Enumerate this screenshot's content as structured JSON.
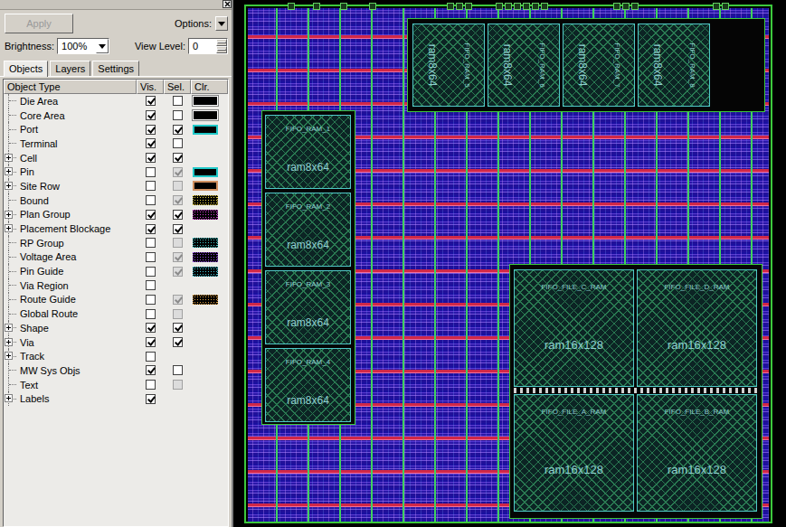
{
  "toolbar": {
    "apply": {
      "label": "Apply",
      "disabled": true
    },
    "options_label": "Options:",
    "brightness_label": "Brightness:",
    "brightness": "100%",
    "view_level_label": "View Level:",
    "view_level": "0"
  },
  "tabs": [
    {
      "label": "Objects",
      "selected": true
    },
    {
      "label": "Layers",
      "selected": false
    },
    {
      "label": "Settings",
      "selected": false
    }
  ],
  "table": {
    "columns": [
      "Object Type",
      "Vis.",
      "Sel.",
      "Clr."
    ],
    "rows": [
      {
        "name": "Die Area",
        "expandable": false,
        "vis": true,
        "sel": {
          "checked": false,
          "disabled": false
        },
        "clr": {
          "kind": "solid",
          "color": "#000000"
        }
      },
      {
        "name": "Core Area",
        "expandable": false,
        "vis": true,
        "sel": {
          "checked": false,
          "disabled": false
        },
        "clr": {
          "kind": "solid",
          "color": "#000000"
        }
      },
      {
        "name": "Port",
        "expandable": false,
        "vis": true,
        "sel": {
          "checked": true,
          "disabled": false
        },
        "clr": {
          "kind": "outline",
          "color": "#20c8c8"
        }
      },
      {
        "name": "Terminal",
        "expandable": false,
        "vis": true,
        "sel": {
          "checked": false,
          "disabled": false
        },
        "clr": null
      },
      {
        "name": "Cell",
        "expandable": true,
        "vis": true,
        "sel": {
          "checked": true,
          "disabled": false
        },
        "clr": null
      },
      {
        "name": "Pin",
        "expandable": true,
        "vis": false,
        "sel": {
          "checked": true,
          "disabled": true
        },
        "clr": {
          "kind": "outline",
          "color": "#20c8c8"
        }
      },
      {
        "name": "Site Row",
        "expandable": true,
        "vis": false,
        "sel": {
          "checked": false,
          "disabled": true
        },
        "clr": {
          "kind": "outline",
          "color": "#d09060"
        }
      },
      {
        "name": "Bound",
        "expandable": false,
        "vis": false,
        "sel": {
          "checked": true,
          "disabled": true
        },
        "clr": {
          "kind": "dotted",
          "color": "#e8d040"
        }
      },
      {
        "name": "Plan Group",
        "expandable": true,
        "vis": true,
        "sel": {
          "checked": true,
          "disabled": false
        },
        "clr": {
          "kind": "dotted",
          "color": "#d040d0"
        }
      },
      {
        "name": "Placement Blockage",
        "expandable": true,
        "vis": true,
        "sel": {
          "checked": true,
          "disabled": false
        },
        "clr": null
      },
      {
        "name": "RP Group",
        "expandable": false,
        "vis": false,
        "sel": {
          "checked": false,
          "disabled": true
        },
        "clr": {
          "kind": "dotted",
          "color": "#40c8c8"
        }
      },
      {
        "name": "Voltage Area",
        "expandable": false,
        "vis": false,
        "sel": {
          "checked": true,
          "disabled": true
        },
        "clr": {
          "kind": "dotted",
          "color": "#9048e0"
        }
      },
      {
        "name": "Pin Guide",
        "expandable": false,
        "vis": false,
        "sel": {
          "checked": true,
          "disabled": true
        },
        "clr": {
          "kind": "dotted",
          "color": "#40c8d8"
        }
      },
      {
        "name": "Via Region",
        "expandable": false,
        "vis": false,
        "sel": null,
        "clr": null
      },
      {
        "name": "Route Guide",
        "expandable": false,
        "vis": false,
        "sel": {
          "checked": true,
          "disabled": true
        },
        "clr": {
          "kind": "dotted",
          "color": "#e0a040"
        }
      },
      {
        "name": "Global Route",
        "expandable": false,
        "vis": false,
        "sel": {
          "checked": false,
          "disabled": true
        },
        "clr": null
      },
      {
        "name": "Shape",
        "expandable": true,
        "vis": true,
        "sel": {
          "checked": true,
          "disabled": false
        },
        "clr": null
      },
      {
        "name": "Via",
        "expandable": true,
        "vis": true,
        "sel": {
          "checked": true,
          "disabled": false
        },
        "clr": null
      },
      {
        "name": "Track",
        "expandable": true,
        "vis": false,
        "sel": null,
        "clr": null
      },
      {
        "name": "MW Sys Objs",
        "expandable": false,
        "vis": true,
        "sel": {
          "checked": false,
          "disabled": false
        },
        "clr": null
      },
      {
        "name": "Text",
        "expandable": false,
        "vis": false,
        "sel": {
          "checked": false,
          "disabled": true
        },
        "clr": null
      },
      {
        "name": "Labels",
        "expandable": true,
        "vis": true,
        "sel": null,
        "clr": null
      }
    ]
  },
  "layout": {
    "macros": [
      {
        "name": "FIFO_RAM_5",
        "cell": "ram8x64",
        "kind": "top"
      },
      {
        "name": "FIFO_RAM_6",
        "cell": "ram8x64",
        "kind": "top"
      },
      {
        "name": "FIFO_RAM_7",
        "cell": "ram8x64",
        "kind": "top"
      },
      {
        "name": "FIFO_RAM_8",
        "cell": "ram8x64",
        "kind": "top"
      },
      {
        "name": "FIFO_RAM_1",
        "cell": "ram8x64",
        "kind": "left"
      },
      {
        "name": "FIFO_RAM_2",
        "cell": "ram8x64",
        "kind": "left"
      },
      {
        "name": "FIFO_RAM_3",
        "cell": "ram8x64",
        "kind": "left"
      },
      {
        "name": "FIFO_RAM_4",
        "cell": "ram8x64",
        "kind": "left"
      },
      {
        "name": "FIFO_FILE_C_RAM",
        "cell": "ram16x128",
        "kind": "big"
      },
      {
        "name": "FIFO_FILE_D_RAM",
        "cell": "ram16x128",
        "kind": "big"
      },
      {
        "name": "FIFO_FILE_A_RAM",
        "cell": "ram16x128",
        "kind": "big"
      },
      {
        "name": "FIFO_FILE_B_RAM",
        "cell": "ram16x128",
        "kind": "big"
      }
    ]
  }
}
